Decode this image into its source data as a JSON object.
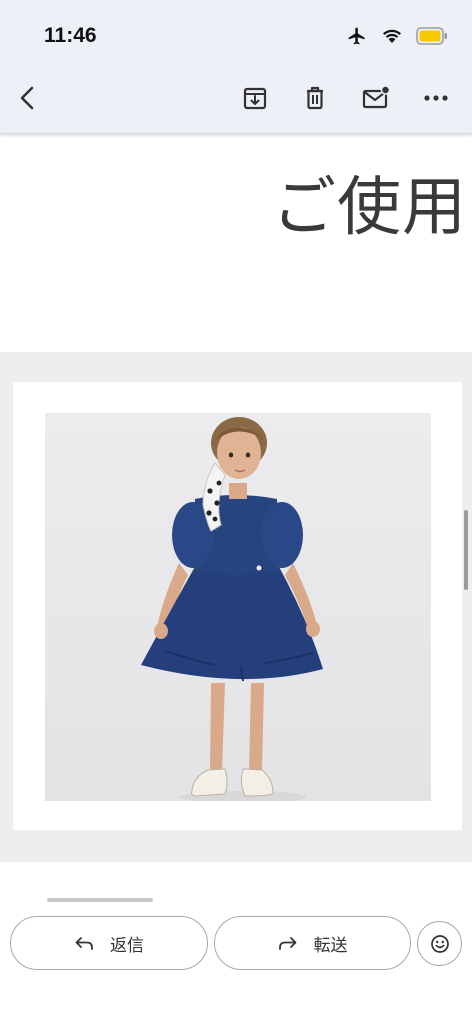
{
  "status_bar": {
    "time": "11:46",
    "icons": [
      "airplane-icon",
      "wifi-icon",
      "battery-icon"
    ],
    "battery_color": "#f7c800"
  },
  "toolbar": {
    "icons": [
      "back-arrow-icon",
      "archive-icon",
      "trash-icon",
      "mark-unread-icon",
      "more-icon"
    ]
  },
  "email": {
    "heading_text": "ご使用",
    "image_subject": "girl-in-navy-dress-photo"
  },
  "actions": {
    "reply_label": "返信",
    "forward_label": "転送",
    "emoji_icon": "smiley-icon"
  },
  "colors": {
    "header_bg": "#edf1f7",
    "content_band": "#eeeeee",
    "dress": "#243f7c"
  }
}
